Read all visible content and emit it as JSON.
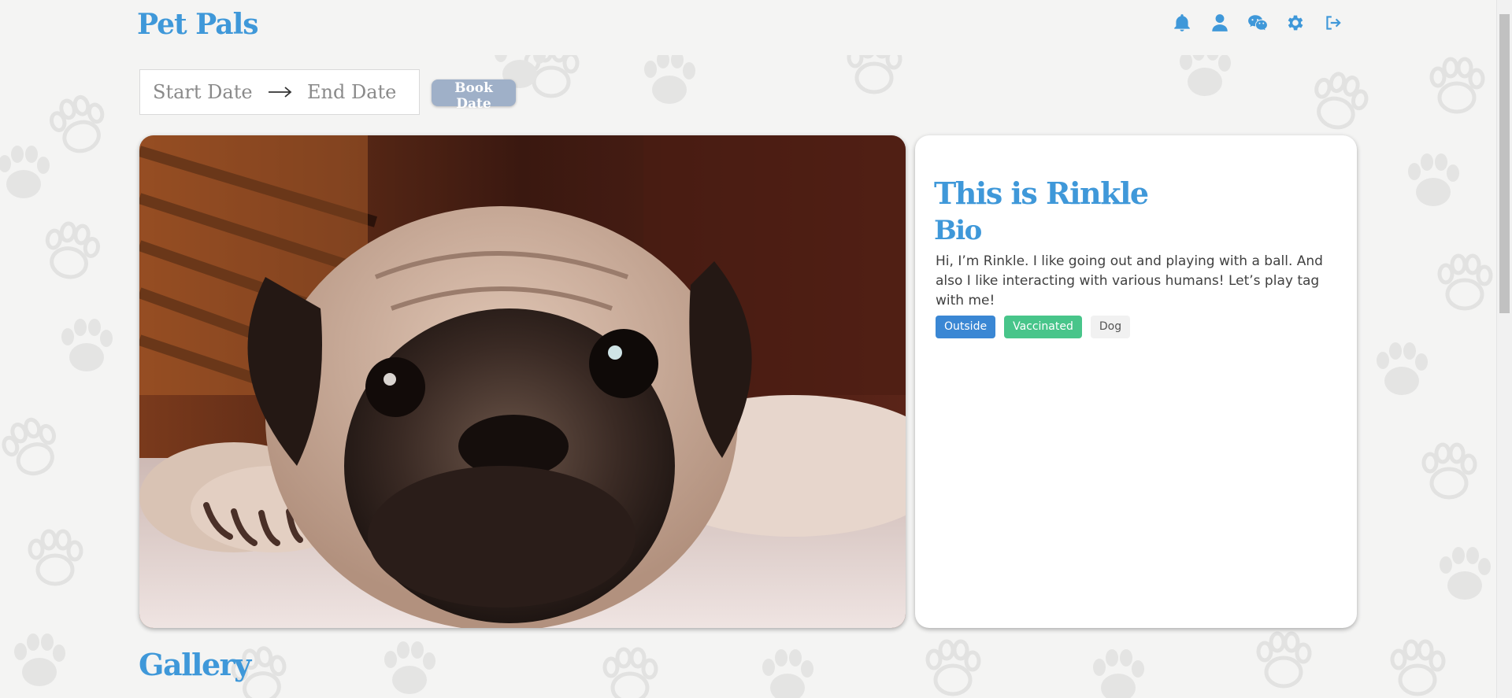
{
  "header": {
    "logo": "Pet Pals",
    "icons": [
      "bell-icon",
      "user-icon",
      "wechat-icon",
      "gear-icon",
      "logout-icon"
    ]
  },
  "booking": {
    "start_placeholder": "Start Date",
    "end_placeholder": "End Date",
    "book_label": "Book Date"
  },
  "pet": {
    "title": "This is Rinkle",
    "bio_heading": "Bio",
    "bio": "Hi, I’m Rinkle. I like going out and playing with a ball. And also I like interacting with various humans! Let’s play tag with me!",
    "tags": [
      {
        "label": "Outside",
        "color": "#3a87d4"
      },
      {
        "label": "Vaccinated",
        "color": "#48c58a"
      },
      {
        "label": "Dog",
        "color": "#f1f1f1"
      }
    ]
  },
  "gallery": {
    "heading": "Gallery"
  },
  "colors": {
    "accent": "#3f98d9",
    "background": "#f4f4f3",
    "button": "#9fb0c8"
  }
}
